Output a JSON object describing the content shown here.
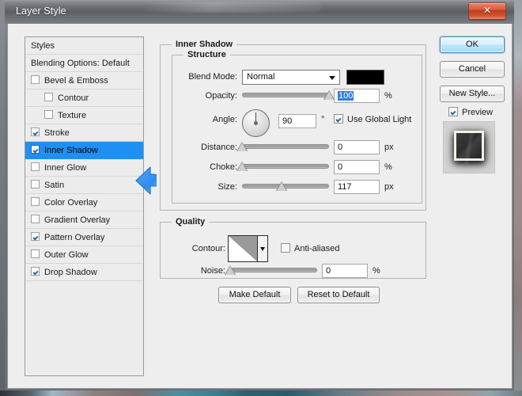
{
  "window": {
    "title": "Layer Style",
    "close_label": "✕"
  },
  "styles_panel": {
    "header": "Styles",
    "blending_options": "Blending Options: Default",
    "items": [
      {
        "label": "Bevel & Emboss",
        "checked": false,
        "sub": false,
        "selected": false
      },
      {
        "label": "Contour",
        "checked": false,
        "sub": true,
        "selected": false
      },
      {
        "label": "Texture",
        "checked": false,
        "sub": true,
        "selected": false
      },
      {
        "label": "Stroke",
        "checked": true,
        "sub": false,
        "selected": false
      },
      {
        "label": "Inner Shadow",
        "checked": true,
        "sub": false,
        "selected": true
      },
      {
        "label": "Inner Glow",
        "checked": false,
        "sub": false,
        "selected": false
      },
      {
        "label": "Satin",
        "checked": false,
        "sub": false,
        "selected": false
      },
      {
        "label": "Color Overlay",
        "checked": false,
        "sub": false,
        "selected": false
      },
      {
        "label": "Gradient Overlay",
        "checked": false,
        "sub": false,
        "selected": false
      },
      {
        "label": "Pattern Overlay",
        "checked": true,
        "sub": false,
        "selected": false
      },
      {
        "label": "Outer Glow",
        "checked": false,
        "sub": false,
        "selected": false
      },
      {
        "label": "Drop Shadow",
        "checked": true,
        "sub": false,
        "selected": false
      }
    ]
  },
  "main": {
    "inner_shadow_group": "Inner Shadow",
    "structure_group": "Structure",
    "quality_group": "Quality",
    "blend_mode": {
      "label": "Blend Mode:",
      "value": "Normal",
      "color": "#000000"
    },
    "opacity": {
      "label": "Opacity:",
      "value": "100",
      "unit": "%",
      "percent": 100
    },
    "angle": {
      "label": "Angle:",
      "value": "90",
      "unit": "°",
      "degrees": 90,
      "use_global_light": {
        "label": "Use Global Light",
        "checked": true
      }
    },
    "distance": {
      "label": "Distance:",
      "value": "0",
      "unit": "px",
      "percent": 0
    },
    "choke": {
      "label": "Choke:",
      "value": "0",
      "unit": "%",
      "percent": 0
    },
    "size": {
      "label": "Size:",
      "value": "117",
      "unit": "px",
      "percent": 45
    },
    "contour": {
      "label": "Contour:"
    },
    "anti_aliased": {
      "label": "Anti-aliased",
      "checked": false
    },
    "noise": {
      "label": "Noise:",
      "value": "0",
      "unit": "%",
      "percent": 0
    },
    "make_default": "Make Default",
    "reset_to_default": "Reset to Default"
  },
  "right": {
    "ok": "OK",
    "cancel": "Cancel",
    "new_style": "New Style...",
    "preview": {
      "label": "Preview",
      "checked": true
    }
  }
}
